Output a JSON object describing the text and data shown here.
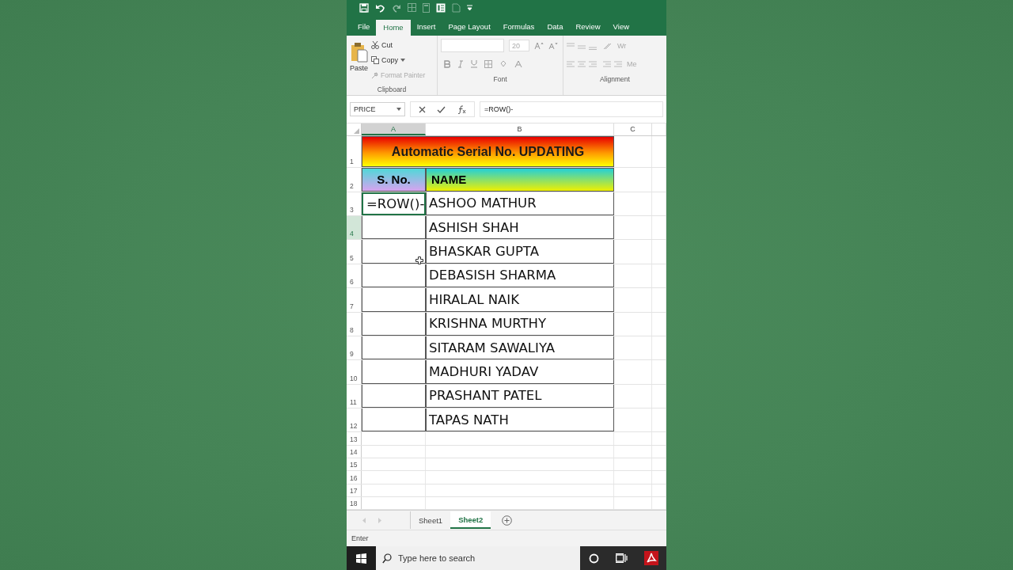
{
  "ribbon_tabs": [
    {
      "label": "File",
      "selected": false
    },
    {
      "label": "Home",
      "selected": true
    },
    {
      "label": "Insert",
      "selected": false
    },
    {
      "label": "Page Layout",
      "selected": false
    },
    {
      "label": "Formulas",
      "selected": false
    },
    {
      "label": "Data",
      "selected": false
    },
    {
      "label": "Review",
      "selected": false
    },
    {
      "label": "View",
      "selected": false
    }
  ],
  "clipboard": {
    "paste": "Paste",
    "cut": "Cut",
    "copy": "Copy",
    "format_painter": "Format Painter",
    "label": "Clipboard"
  },
  "font": {
    "size": "20",
    "label": "Font"
  },
  "alignment": {
    "wrap_text": "Wr",
    "merge": "Me",
    "label": "Alignment"
  },
  "formula_bar": {
    "name_box": "PRICE",
    "formula": "=ROW()-"
  },
  "sheet": {
    "columns": [
      {
        "label": "A",
        "selected": true
      },
      {
        "label": "B",
        "selected": false
      },
      {
        "label": "C",
        "selected": false
      }
    ],
    "rows": [
      {
        "number": "1",
        "selected": false
      },
      {
        "number": "2",
        "selected": false
      },
      {
        "number": "3",
        "selected": false
      },
      {
        "number": "4",
        "selected": true
      },
      {
        "number": "5",
        "selected": false
      },
      {
        "number": "6",
        "selected": false
      },
      {
        "number": "7",
        "selected": false
      },
      {
        "number": "8",
        "selected": false
      },
      {
        "number": "9",
        "selected": false
      },
      {
        "number": "10",
        "selected": false
      },
      {
        "number": "11",
        "selected": false
      },
      {
        "number": "12",
        "selected": false
      },
      {
        "number": "13",
        "selected": false
      },
      {
        "number": "14",
        "selected": false
      },
      {
        "number": "15",
        "selected": false
      },
      {
        "number": "16",
        "selected": false
      },
      {
        "number": "17",
        "selected": false
      },
      {
        "number": "18",
        "selected": false
      }
    ]
  },
  "table": {
    "title": "Automatic Serial No. UPDATING",
    "headers": [
      "S. No.",
      "NAME"
    ],
    "rows": [
      {
        "serial": "=ROW()-",
        "name": "ASHOO MATHUR",
        "editing": true
      },
      {
        "name": "ASHISH SHAH",
        "editing": false
      },
      {
        "name": "BHASKAR GUPTA",
        "editing": false
      },
      {
        "name": "DEBASISH SHARMA",
        "editing": false
      },
      {
        "name": "HIRALAL NAIK",
        "editing": false
      },
      {
        "name": "KRISHNA MURTHY",
        "editing": false
      },
      {
        "name": "SITARAM SAWALIYA",
        "editing": false
      },
      {
        "name": "MADHURI YADAV",
        "editing": false
      },
      {
        "name": "PRASHANT PATEL",
        "editing": false
      },
      {
        "name": "TAPAS NATH",
        "editing": false
      }
    ]
  },
  "sheet_tabs": [
    {
      "label": "Sheet1",
      "selected": false
    },
    {
      "label": "Sheet2",
      "selected": true
    }
  ],
  "status_bar": {
    "mode": "Enter"
  },
  "taskbar": {
    "search_placeholder": "Type here to search"
  }
}
